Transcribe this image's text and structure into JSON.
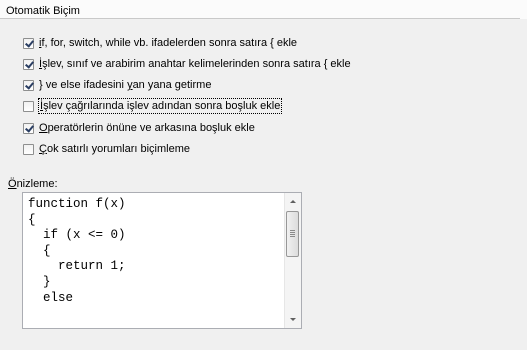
{
  "group": {
    "title": "Otomatik Biçim"
  },
  "options": [
    {
      "pre": "",
      "u": "i",
      "post": "f, for, switch, while vb. ifadelerden sonra satıra { ekle",
      "checked": true
    },
    {
      "pre": "",
      "u": "İ",
      "post": "şlev, sınıf ve arabirim anahtar kelimelerinden sonra satıra { ekle",
      "checked": true
    },
    {
      "pre": "} ve else ifadesini ",
      "u": "y",
      "post": "an yana getirme",
      "checked": true
    },
    {
      "pre": "",
      "u": "İ",
      "post": "şlev çağrılarında işlev adından sonra boşluk ekle",
      "checked": false
    },
    {
      "pre": "",
      "u": "O",
      "post": "peratörlerin önüne ve arkasına boşluk ekle",
      "checked": true
    },
    {
      "pre": "",
      "u": "Ç",
      "post": "ok satırlı yorumları biçimleme",
      "checked": false
    }
  ],
  "preview": {
    "label_u": "Ö",
    "label_rest": "nizleme:",
    "code": "function f(x)\n{\n  if (x <= 0)\n  {\n    return 1;\n  }\n  else"
  }
}
